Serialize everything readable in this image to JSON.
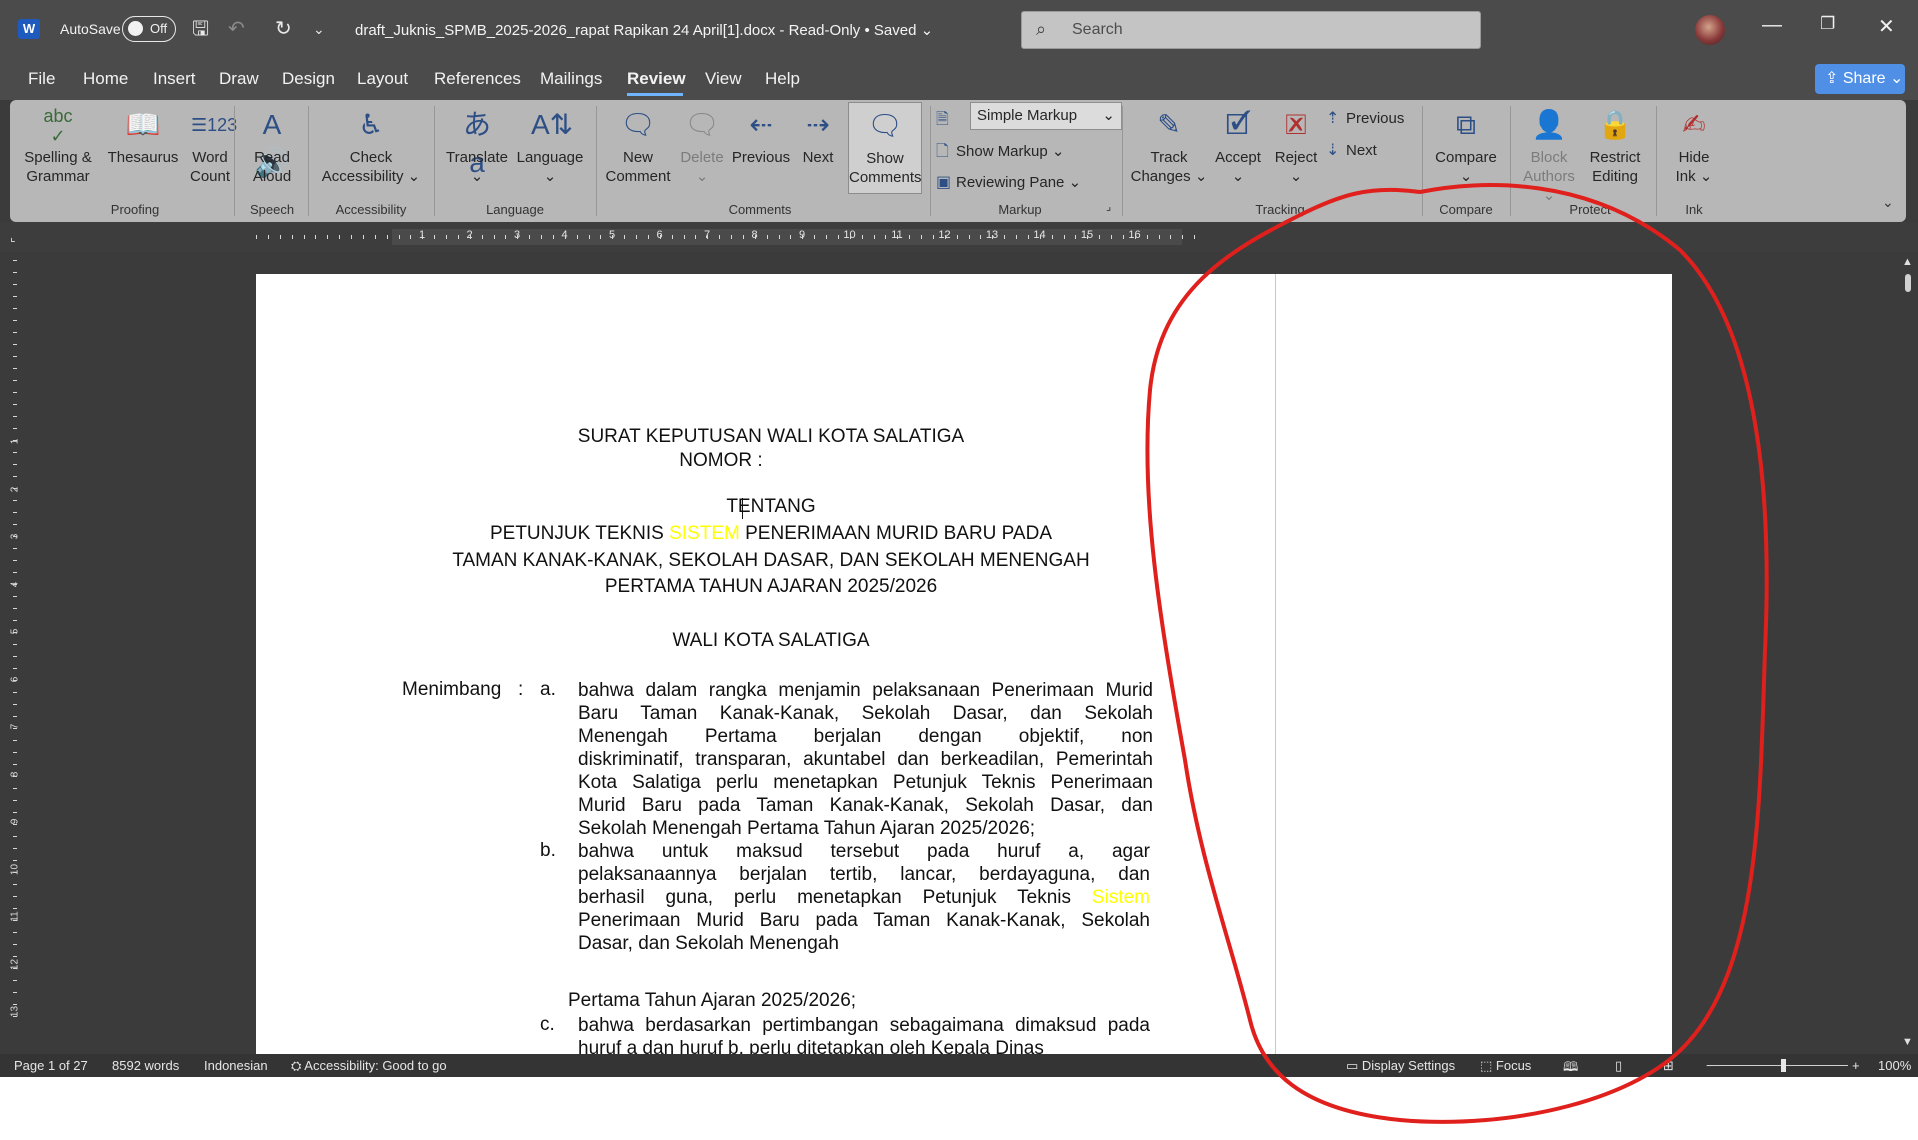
{
  "titlebar": {
    "app_logo": "W",
    "autosave_label": "AutoSave",
    "autosave_state": "Off",
    "doc_title": "draft_Juknis_SPMB_2025-2026_rapat Rapikan 24 April[1].docx  -  Read-Only • Saved ⌄",
    "search_placeholder": "Search",
    "icons": [
      "save-icon",
      "undo-icon",
      "redo-icon",
      "customize-icon",
      "minimize-icon",
      "restore-icon",
      "close-icon"
    ]
  },
  "menu": {
    "tabs": [
      "File",
      "Home",
      "Insert",
      "Draw",
      "Design",
      "Layout",
      "References",
      "Mailings",
      "Review",
      "View",
      "Help"
    ],
    "active": "Review",
    "share_label": "Share ⌄"
  },
  "ribbon": {
    "proofing": {
      "spelling": "Spelling &",
      "spelling2": "Grammar",
      "thesaurus": "Thesaurus",
      "word_count": "Word",
      "word_count2": "Count",
      "label": "Proofing"
    },
    "speech": {
      "read_aloud": "Read",
      "read_aloud2": "Aloud",
      "label": "Speech"
    },
    "accessibility": {
      "check": "Check",
      "check2": "Accessibility ⌄",
      "label": "Accessibility"
    },
    "language": {
      "translate": "Translate",
      "language": "Language",
      "label": "Language"
    },
    "comments": {
      "new": "New",
      "new2": "Comment",
      "delete": "Delete",
      "previous": "Previous",
      "next": "Next",
      "show": "Show",
      "show2": "Comments",
      "label": "Comments"
    },
    "markup": {
      "select": "Simple Markup",
      "show_markup": "Show Markup ⌄",
      "reviewing_pane": "Reviewing Pane ⌄",
      "label": "Markup"
    },
    "tracking": {
      "track": "Track",
      "track2": "Changes ⌄",
      "accept": "Accept",
      "reject": "Reject",
      "previous": "Previous",
      "next": "Next",
      "label": "Tracking"
    },
    "compare": {
      "compare": "Compare",
      "label": "Compare"
    },
    "protect": {
      "block": "Block",
      "block2": "Authors ⌄",
      "restrict": "Restrict",
      "restrict2": "Editing",
      "label": "Protect"
    },
    "ink": {
      "hide": "Hide",
      "hide2": "Ink ⌄",
      "label": "Ink"
    }
  },
  "ruler": {
    "numbers": [
      "1",
      "2",
      "3",
      "4",
      "5",
      "6",
      "7",
      "8",
      "9",
      "10",
      "11",
      "12",
      "13",
      "14",
      "15",
      "16"
    ]
  },
  "vruler": {
    "numbers": [
      "1",
      "2",
      "3",
      "4",
      "5",
      "6",
      "7",
      "8",
      "9",
      "10",
      "11",
      "12",
      "13"
    ]
  },
  "document": {
    "title1": "SURAT KEPUTUSAN WALI  KOTA SALATIGA",
    "nomor": "NOMOR :",
    "tentang": "TENTANG",
    "subject1_pre": "PETUNJUK TEKNIS ",
    "subject1_hl": "SISTEM",
    "subject1_post": " PENERIMAAN MURID BARU PADA",
    "subject2": "TAMAN KANAK-KANAK, SEKOLAH DASAR, DAN SEKOLAH MENENGAH",
    "subject3": "PERTAMA TAHUN AJARAN 2025/2026",
    "wali": "WALI KOTA SALATIGA",
    "menimbang": "Menimbang",
    "colon": ":",
    "items": [
      {
        "letter": "a.",
        "lines": [
          "bahwa dalam rangka menjamin pelaksanaan Penerimaan Murid",
          "Baru Taman Kanak-Kanak, Sekolah Dasar, dan Sekolah",
          "Menengah Pertama berjalan dengan objektif, non",
          "diskriminatif, transparan, akuntabel dan berkeadilan, Pemerintah",
          "Kota Salatiga perlu menetapkan Petunjuk Teknis Penerimaan",
          "Murid Baru pada Taman Kanak-Kanak, Sekolah Dasar, dan",
          "Sekolah Menengah Pertama Tahun Ajaran 2025/2026;"
        ]
      },
      {
        "letter": "b.",
        "lines": [
          "bahwa untuk maksud tersebut pada huruf a, agar",
          "pelaksanaannya berjalan tertib, lancar, berdayaguna, dan",
          "berhasil guna, perlu menetapkan Petunjuk Teknis",
          "Penerimaan Murid Baru pada Taman  Kanak-Kanak,  Sekolah",
          "Dasar, dan Sekolah Menengah"
        ],
        "hl_word": "Sistem"
      },
      {
        "letter": "c.",
        "lines": [
          "bahwa berdasarkan pertimbangan sebagaimana dimaksud pada",
          "huruf a dan huruf b, perlu ditetapkan oleh Kepala Dinas"
        ]
      }
    ],
    "orphan_line": "Pertama Tahun Ajaran 2025/2026;"
  },
  "statusbar": {
    "page": "Page 1 of 27",
    "words": "8592 words",
    "language": "Indonesian",
    "accessibility": "Accessibility: Good to go",
    "display_settings": "Display Settings",
    "focus": "Focus",
    "zoom": "100%"
  },
  "colors": {
    "annotation": "#e0201c",
    "highlight": "#ffff00",
    "accent": "#6eb4ff"
  }
}
